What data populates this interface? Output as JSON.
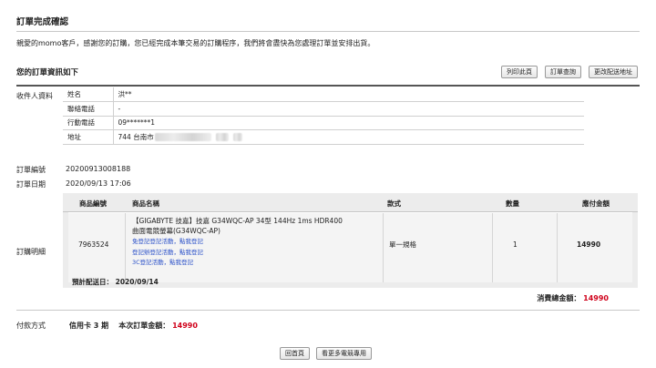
{
  "header": {
    "title": "訂單完成確認",
    "greeting": "親愛的momo客戶，感謝您的訂購，您已經完成本筆交易的訂購程序，我們將會盡快為您處理訂單並安排出貨。"
  },
  "order_info": {
    "title": "您的訂單資訊如下",
    "buttons": {
      "print": "列印此頁",
      "query": "訂單查詢",
      "change_address": "更改配送地址"
    }
  },
  "recipient": {
    "section_label": "收件人資料",
    "rows": [
      {
        "label": "姓名",
        "value": "洪**"
      },
      {
        "label": "聯絡電話",
        "value": "-"
      },
      {
        "label": "行動電話",
        "value": "09*******1"
      },
      {
        "label": "地址",
        "value": "744 台南市"
      }
    ]
  },
  "order": {
    "number_label": "訂單編號",
    "number": "20200913008188",
    "date_label": "訂單日期",
    "date": "2020/09/13 17:06"
  },
  "items": {
    "section_label": "訂購明細",
    "headers": {
      "code": "商品編號",
      "name": "商品名稱",
      "style": "款式",
      "qty": "數量",
      "amount": "應付金額"
    },
    "rows": [
      {
        "code": "7963524",
        "name_line1": "【GIGABYTE 技嘉】技嘉 G34WQC-AP 34型 144Hz 1ms HDR400",
        "name_line2": "曲面電競螢幕(G34WQC-AP)",
        "links": [
          "免登記登記活動，點我登記",
          "登記辦登記活動，點我登記",
          "3C登記活動，點我登記"
        ],
        "style": "單一規格",
        "qty": "1",
        "amount": "14990"
      }
    ],
    "ship_label": "預計配送日：",
    "ship_date": "2020/09/14"
  },
  "totals": {
    "label": "消費總金額：",
    "value": "14990"
  },
  "payment": {
    "label": "付款方式",
    "method": "信用卡 3 期",
    "amount_label": "本次訂單金額：",
    "amount": "14990"
  },
  "footer": {
    "home": "回首頁",
    "more": "看更多電競專用"
  },
  "colors": {
    "accent_red": "#d0021b",
    "link_blue": "#2a50c8"
  }
}
